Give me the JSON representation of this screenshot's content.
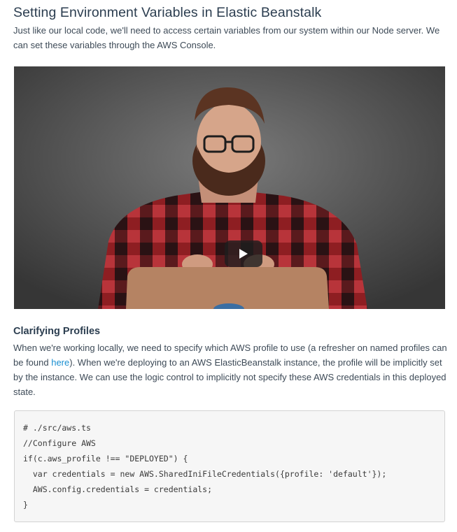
{
  "article": {
    "title": "Setting Environment Variables in Elastic Beanstalk",
    "intro": "Just like our local code, we'll need to access certain variables from our system within our Node server. We can set these variables through the AWS Console."
  },
  "video": {
    "play_icon": "play-icon"
  },
  "section": {
    "heading": "Clarifying Profiles",
    "body_before_link": "When we're working locally, we need to specify which AWS profile to use (a refresher on named profiles can be found ",
    "link_text": "here",
    "body_after_link": "). When we're deploying to an AWS ElasticBeanstalk instance, the profile will be implicitly set by the instance. We can use the logic control to implicitly not specify these AWS credentials in this deployed state."
  },
  "code": {
    "lines": [
      "# ./src/aws.ts",
      "//Configure AWS",
      "if(c.aws_profile !== \"DEPLOYED\") {",
      "  var credentials = new AWS.SharedIniFileCredentials({profile: 'default'});",
      "  AWS.config.credentials = credentials;",
      "}"
    ]
  },
  "colors": {
    "link": "#1a8fd1",
    "heading": "#2c3e50",
    "body_text": "#3d4a57",
    "code_background": "#f6f6f6"
  }
}
